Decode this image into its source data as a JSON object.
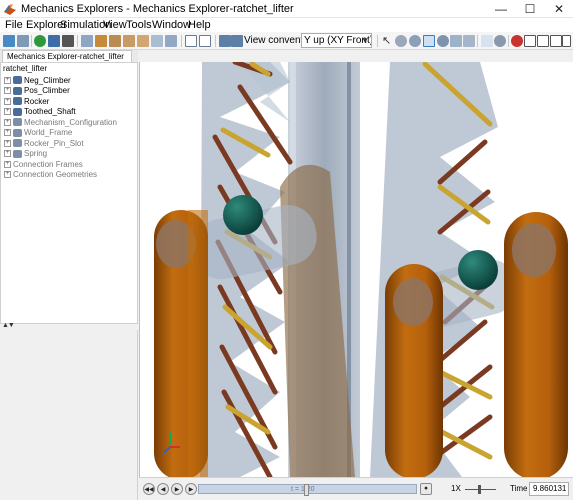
{
  "window": {
    "title": "Mechanics Explorers - Mechanics Explorer-ratchet_lifter",
    "minimize_glyph": "—",
    "maximize_glyph": "☐",
    "close_glyph": "✕"
  },
  "menu": [
    "File",
    "Explorer",
    "Simulation",
    "View",
    "Tools",
    "Window",
    "Help"
  ],
  "toolbar": {
    "view_convention_label": "View convention:",
    "view_convention_value": "Y up (XY Front)"
  },
  "explorer": {
    "tab_label": "Mechanics Explorer-ratchet_lifter",
    "tree": {
      "root": "ratchet_lifter",
      "items": [
        {
          "label": "Neg_Climber",
          "icon": "subsystem-icon",
          "dim": false
        },
        {
          "label": "Pos_Climber",
          "icon": "subsystem-icon",
          "dim": false
        },
        {
          "label": "Rocker",
          "icon": "subsystem-icon",
          "dim": false
        },
        {
          "label": "Toothed_Shaft",
          "icon": "subsystem-icon",
          "dim": false
        },
        {
          "label": "Mechanism_Configuration",
          "icon": "config-icon",
          "dim": true
        },
        {
          "label": "World_Frame",
          "icon": "frame-icon",
          "dim": true
        },
        {
          "label": "Rocker_Pin_Slot",
          "icon": "joint-icon",
          "dim": true
        },
        {
          "label": "Spring",
          "icon": "spring-icon",
          "dim": true
        },
        {
          "label": "Connection Frames",
          "icon": "",
          "dim": true
        },
        {
          "label": "Connection Geometries",
          "icon": "",
          "dim": true
        }
      ]
    }
  },
  "playback": {
    "timeline_text": "t = 1.20",
    "timeline_progress": 0.49,
    "speed_label": "1X",
    "speed_level": 0.45,
    "time_label": "Time",
    "time_value": "9.860131"
  },
  "colors": {
    "accent_blue": "#1f6fbf",
    "bronze": "#b5650d",
    "rod_brown": "#7a3a22",
    "rod_gold": "#c9a430",
    "glass_blue": "#a9b7c7",
    "ball_teal": "#0f5b52"
  }
}
